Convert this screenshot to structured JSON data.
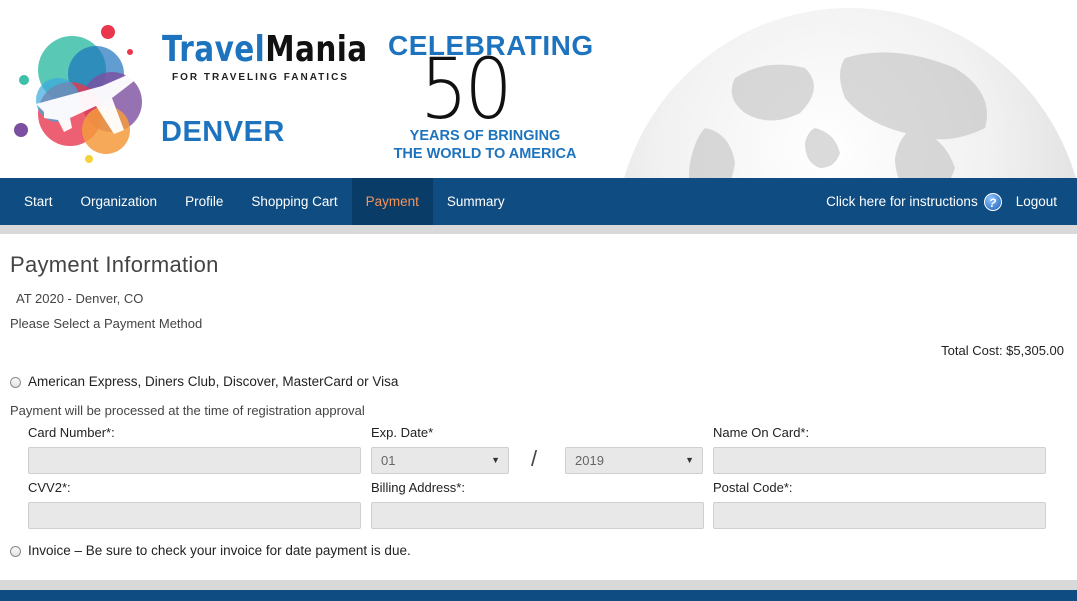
{
  "header": {
    "brand_part1": "Travel",
    "brand_part2": "Mania",
    "tagline": "FOR TRAVELING FANATICS",
    "city": "DENVER",
    "celebrating": "CELEBRATING",
    "anniversary_number": "50",
    "years_line1": "YEARS OF BRINGING",
    "years_line2": "THE WORLD TO AMERICA"
  },
  "nav": {
    "items": [
      {
        "label": "Start",
        "active": false
      },
      {
        "label": "Organization",
        "active": false
      },
      {
        "label": "Profile",
        "active": false
      },
      {
        "label": "Shopping Cart",
        "active": false
      },
      {
        "label": "Payment",
        "active": true
      },
      {
        "label": "Summary",
        "active": false
      }
    ],
    "instructions_label": "Click here for instructions",
    "help_icon": "?",
    "logout_label": "Logout",
    "active_color": "#f4935a",
    "bar_color": "#0f4c81"
  },
  "main": {
    "title": "Payment Information",
    "event_name": "AT 2020 - Denver, CO",
    "select_prompt": "Please Select a Payment Method",
    "total_cost": "Total Cost: $5,305.00",
    "card_option": {
      "label": "American Express, Diners Club, Discover, MasterCard or Visa",
      "selected": false
    },
    "processing_note": "Payment will be processed at the time of registration approval",
    "fields": {
      "card_number_label": "Card Number*:",
      "card_number_value": "",
      "exp_date_label": "Exp. Date*",
      "exp_month": "01",
      "exp_separator": "/",
      "exp_year": "2019",
      "name_on_card_label": "Name On Card*:",
      "name_on_card_value": "",
      "cvv2_label": "CVV2*:",
      "cvv2_value": "",
      "billing_address_label": "Billing Address*:",
      "billing_address_value": "",
      "postal_code_label": "Postal Code*:",
      "postal_code_value": ""
    },
    "invoice_option": {
      "label": "Invoice – Be sure to check your invoice for date payment is due.",
      "selected": false
    }
  }
}
